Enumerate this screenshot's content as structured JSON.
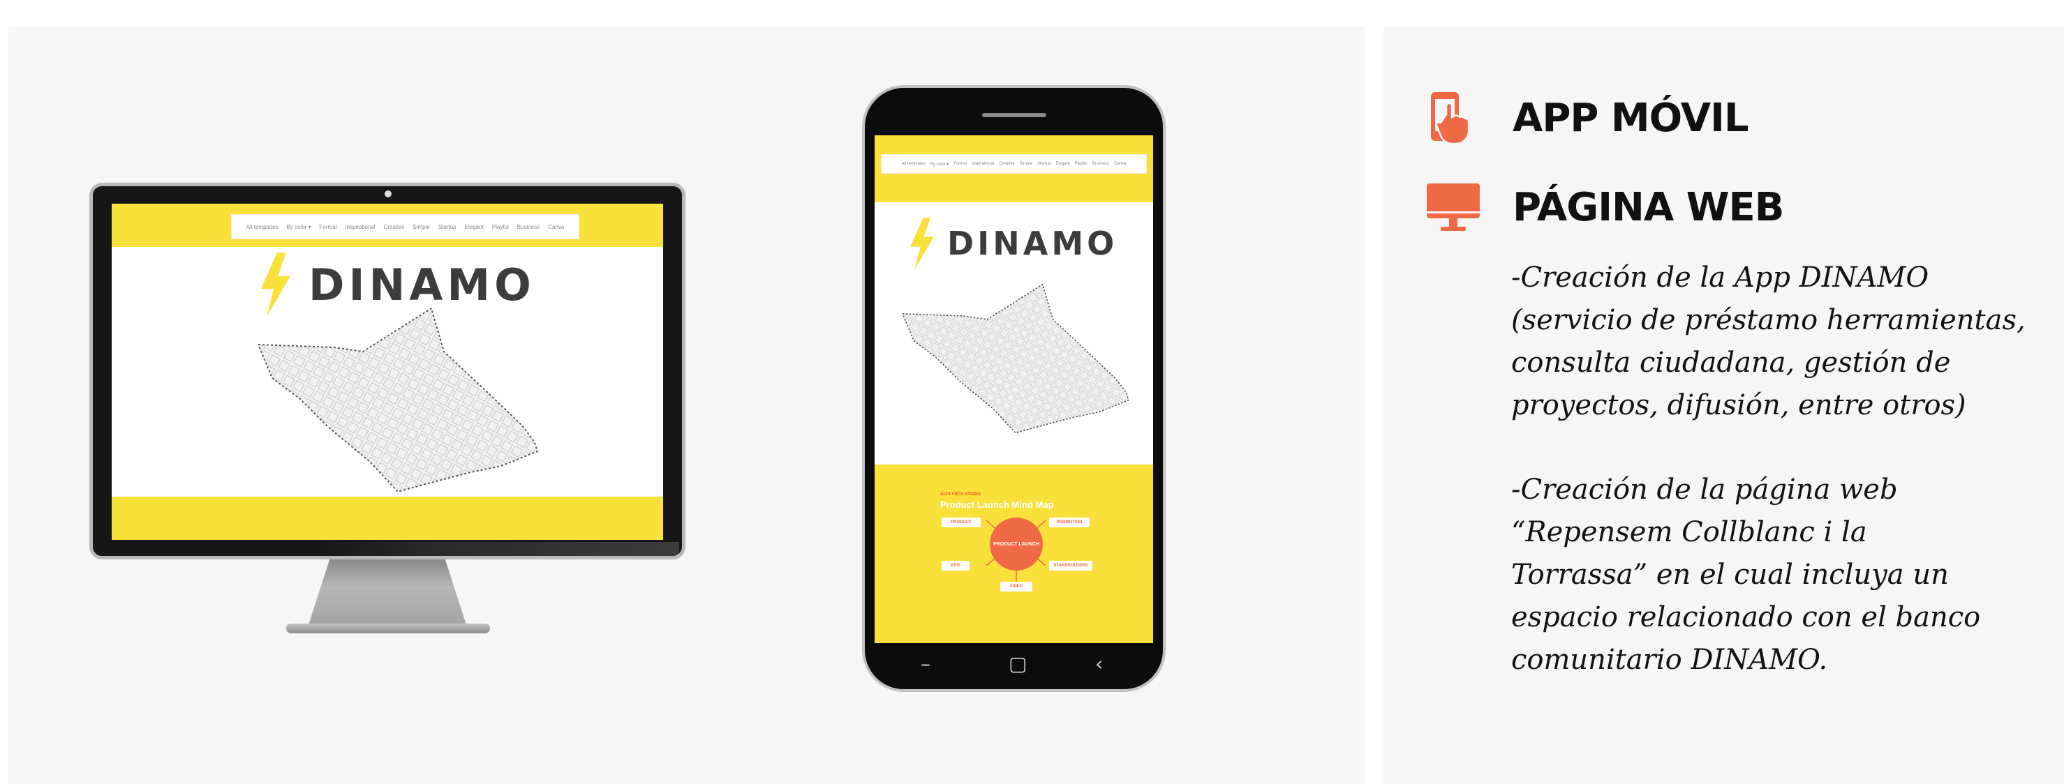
{
  "brand": {
    "name": "DINAMO",
    "yellow": "#fae03a",
    "accent": "#ef6a44",
    "dark": "#3c3c3c"
  },
  "nav_items": [
    "All templates",
    "By color ▾",
    "Formal",
    "Inspirational",
    "Creative",
    "Simple",
    "Startup",
    "Elegant",
    "Playful",
    "Business",
    "Canva"
  ],
  "mindmap": {
    "kicker": "ALTA VISTA STUDIO",
    "title": "Product Launch Mind Map",
    "center": "PRODUCT LAUNCH",
    "nodes": [
      "PRODUCT",
      "PROMOTION",
      "KPIS",
      "STAKEHOLDERS",
      "VIDEO"
    ]
  },
  "sections": [
    {
      "icon": "mobile-tap-icon",
      "title": "APP MÓVIL"
    },
    {
      "icon": "desktop-monitor-icon",
      "title": "PÁGINA WEB"
    }
  ],
  "paragraphs": [
    [
      "-Creación de la App DINAMO",
      "(servicio de préstamo herramientas,",
      "consulta ciudadana, gestión de",
      "proyectos, difusión, entre otros)"
    ],
    [
      "-Creación de la página web",
      "“Repensem Collblanc i la",
      "Torrassa” en el cual incluya un",
      "espacio relacionado con el banco",
      "comunitario DINAMO."
    ]
  ]
}
